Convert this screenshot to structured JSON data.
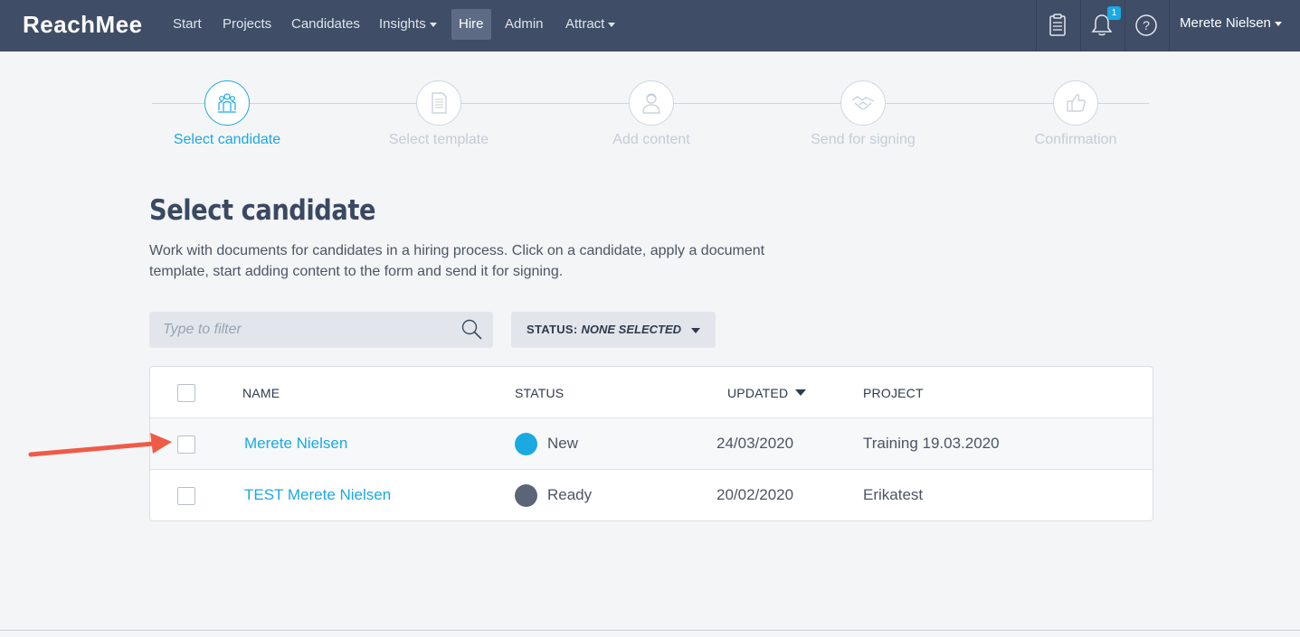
{
  "app": {
    "brand": "ReachMee"
  },
  "nav": {
    "items": [
      {
        "label": "Start",
        "dropdown": false,
        "active": false
      },
      {
        "label": "Projects",
        "dropdown": false,
        "active": false
      },
      {
        "label": "Candidates",
        "dropdown": false,
        "active": false
      },
      {
        "label": "Insights",
        "dropdown": true,
        "active": false
      },
      {
        "label": "Hire",
        "dropdown": false,
        "active": true
      },
      {
        "label": "Admin",
        "dropdown": false,
        "active": false
      },
      {
        "label": "Attract",
        "dropdown": true,
        "active": false
      }
    ],
    "notification_count": "1",
    "user": "Merete Nielsen",
    "icons": [
      "clipboard-icon",
      "bell-icon",
      "help-icon"
    ]
  },
  "steps": [
    {
      "label": "Select candidate",
      "icon": "people-icon",
      "active": true
    },
    {
      "label": "Select template",
      "icon": "document-icon",
      "active": false
    },
    {
      "label": "Add content",
      "icon": "person-icon",
      "active": false
    },
    {
      "label": "Send for signing",
      "icon": "handshake-icon",
      "active": false
    },
    {
      "label": "Confirmation",
      "icon": "thumbs-up-icon",
      "active": false
    }
  ],
  "main": {
    "title": "Select candidate",
    "intro": "Work with documents for candidates in a hiring process. Click on a candidate, apply a document template, start adding content to the form and send it for signing."
  },
  "filter": {
    "placeholder": "Type to filter"
  },
  "status_filter": {
    "label": "STATUS:",
    "value": "NONE SELECTED"
  },
  "table": {
    "columns": {
      "name": "NAME",
      "status": "STATUS",
      "updated": "UPDATED",
      "project": "PROJECT"
    },
    "rows": [
      {
        "name": "Merete Nielsen",
        "status": "New",
        "status_color": "#1aa9e3",
        "updated": "24/03/2020",
        "project": "Training 19.03.2020"
      },
      {
        "name": "TEST Merete Nielsen",
        "status": "Ready",
        "status_color": "#5c6478",
        "updated": "20/02/2020",
        "project": "Erikatest"
      }
    ]
  },
  "colors": {
    "topbar": "#3f4d66",
    "accent": "#1aa9e3",
    "annotation_arrow": "#ef5b47"
  }
}
